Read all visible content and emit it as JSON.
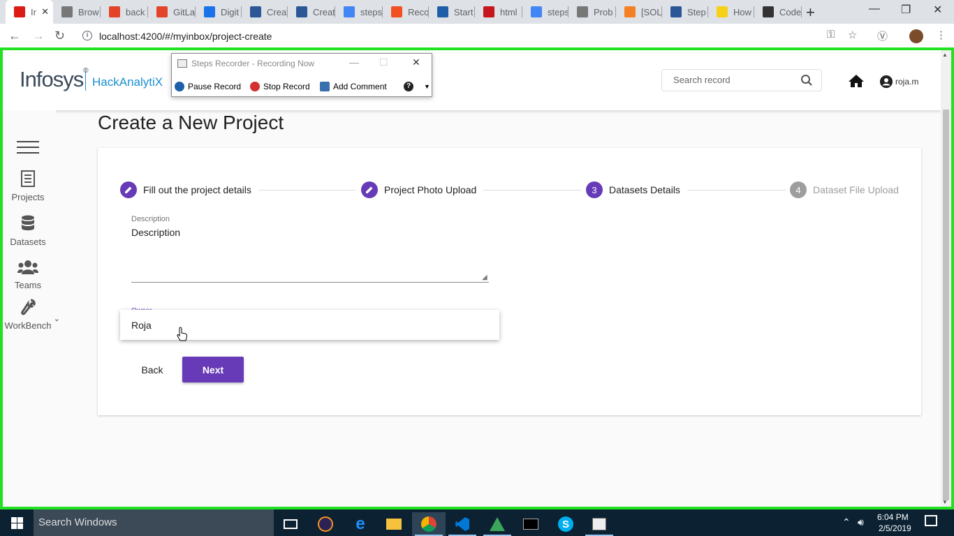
{
  "browser": {
    "tabs": [
      {
        "label": "Ir",
        "icon": "angular-icon",
        "color": "#dd1b16",
        "active": true
      },
      {
        "label": "Brow",
        "icon": "document-icon",
        "color": "#777777"
      },
      {
        "label": "back",
        "icon": "gitlab-icon",
        "color": "#e24329"
      },
      {
        "label": "GitLa",
        "icon": "gitlab-icon",
        "color": "#e24329"
      },
      {
        "label": "Digit",
        "icon": "k-icon",
        "color": "#1a73e8"
      },
      {
        "label": "Creat",
        "icon": "page-icon",
        "color": "#2b5797"
      },
      {
        "label": "Creat",
        "icon": "page-icon",
        "color": "#2b5797"
      },
      {
        "label": "steps",
        "icon": "google-icon",
        "color": "#4285f4"
      },
      {
        "label": "Reco",
        "icon": "microsoft-icon",
        "color": "#f25022"
      },
      {
        "label": "Start",
        "icon": "flag-icon",
        "color": "#1f5fa8"
      },
      {
        "label": "html",
        "icon": "n-icon",
        "color": "#c4161c"
      },
      {
        "label": "steps",
        "icon": "google-icon",
        "color": "#4285f4"
      },
      {
        "label": "Prob",
        "icon": "document-icon",
        "color": "#777777"
      },
      {
        "label": "[SOL",
        "icon": "stack-icon",
        "color": "#f48024"
      },
      {
        "label": "Step",
        "icon": "page-icon",
        "color": "#2b5797"
      },
      {
        "label": "How",
        "icon": "lifehacker-icon",
        "color": "#f7d117"
      },
      {
        "label": "Code",
        "icon": "codepen-icon",
        "color": "#333333"
      }
    ],
    "url": "localhost:4200/#/myinbox/project-create"
  },
  "recorder": {
    "title": "Steps Recorder - Recording Now",
    "pause_label": "Pause Record",
    "stop_label": "Stop Record",
    "comment_label": "Add Comment",
    "help_label": "?"
  },
  "header": {
    "brand": "Infosys",
    "brand_mark": "®",
    "product": "HackAnalytiX",
    "search_placeholder": "Search record",
    "username": "roja.m"
  },
  "sidebar": {
    "items": [
      {
        "label": "Projects",
        "icon": "document-icon"
      },
      {
        "label": "Datasets",
        "icon": "database-icon"
      },
      {
        "label": "Teams",
        "icon": "users-icon"
      },
      {
        "label": "WorkBench",
        "icon": "wrench-icon"
      }
    ]
  },
  "main": {
    "title": "Create a New Project",
    "steps": [
      {
        "label": "Fill out the project details",
        "marker": "",
        "state": "done"
      },
      {
        "label": "Project Photo Upload",
        "marker": "",
        "state": "done"
      },
      {
        "label": "Datasets Details",
        "marker": "3",
        "state": "current"
      },
      {
        "label": "Dataset File Upload",
        "marker": "4",
        "state": "inactive"
      }
    ],
    "description_label": "Description",
    "description_value": "Description",
    "owner_label": "Owner",
    "owner_option": "Roja",
    "back_label": "Back",
    "next_label": "Next"
  },
  "taskbar": {
    "search_text": "Search Windows",
    "time": "6:04 PM",
    "date": "2/5/2019"
  },
  "colors": {
    "accent": "#673ab7",
    "brand_blue": "#1a8fd1",
    "recording_border": "#22e022",
    "taskbar": "#0c2233"
  }
}
